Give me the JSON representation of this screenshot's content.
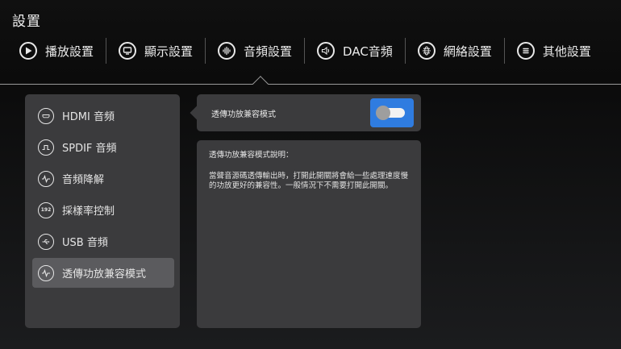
{
  "header": {
    "title": "設置"
  },
  "tabs": [
    {
      "label": "播放設置",
      "icon": "play-icon"
    },
    {
      "label": "顯示設置",
      "icon": "monitor-icon"
    },
    {
      "label": "音頻設置",
      "icon": "audio-wave-icon"
    },
    {
      "label": "DAC音頻",
      "icon": "speaker-icon"
    },
    {
      "label": "網絡設置",
      "icon": "globe-icon"
    },
    {
      "label": "其他設置",
      "icon": "menu-icon"
    }
  ],
  "active_tab": "音頻設置",
  "sidebar": {
    "items": [
      {
        "label": "HDMI 音頻",
        "icon": "hdmi-icon"
      },
      {
        "label": "SPDIF 音頻",
        "icon": "spdif-icon"
      },
      {
        "label": "音頻降解",
        "icon": "waveform-icon"
      },
      {
        "label": "採樣率控制",
        "icon": "sample-rate-192-icon",
        "icon_text": "192"
      },
      {
        "label": "USB 音頻",
        "icon": "usb-icon"
      },
      {
        "label": "透傳功放兼容模式",
        "icon": "waveform-icon"
      }
    ],
    "active": "透傳功放兼容模式"
  },
  "setting": {
    "label": "透傳功放兼容模式",
    "toggle_on": false,
    "accent_color": "#2f7ce0"
  },
  "description": {
    "title": "透傳功放兼容模式說明：",
    "body": "當聲音源碼透傳輸出時，打開此開關將會給一些處理速度慢的功放更好的兼容性。一般情況下不需要打開此開關。"
  }
}
